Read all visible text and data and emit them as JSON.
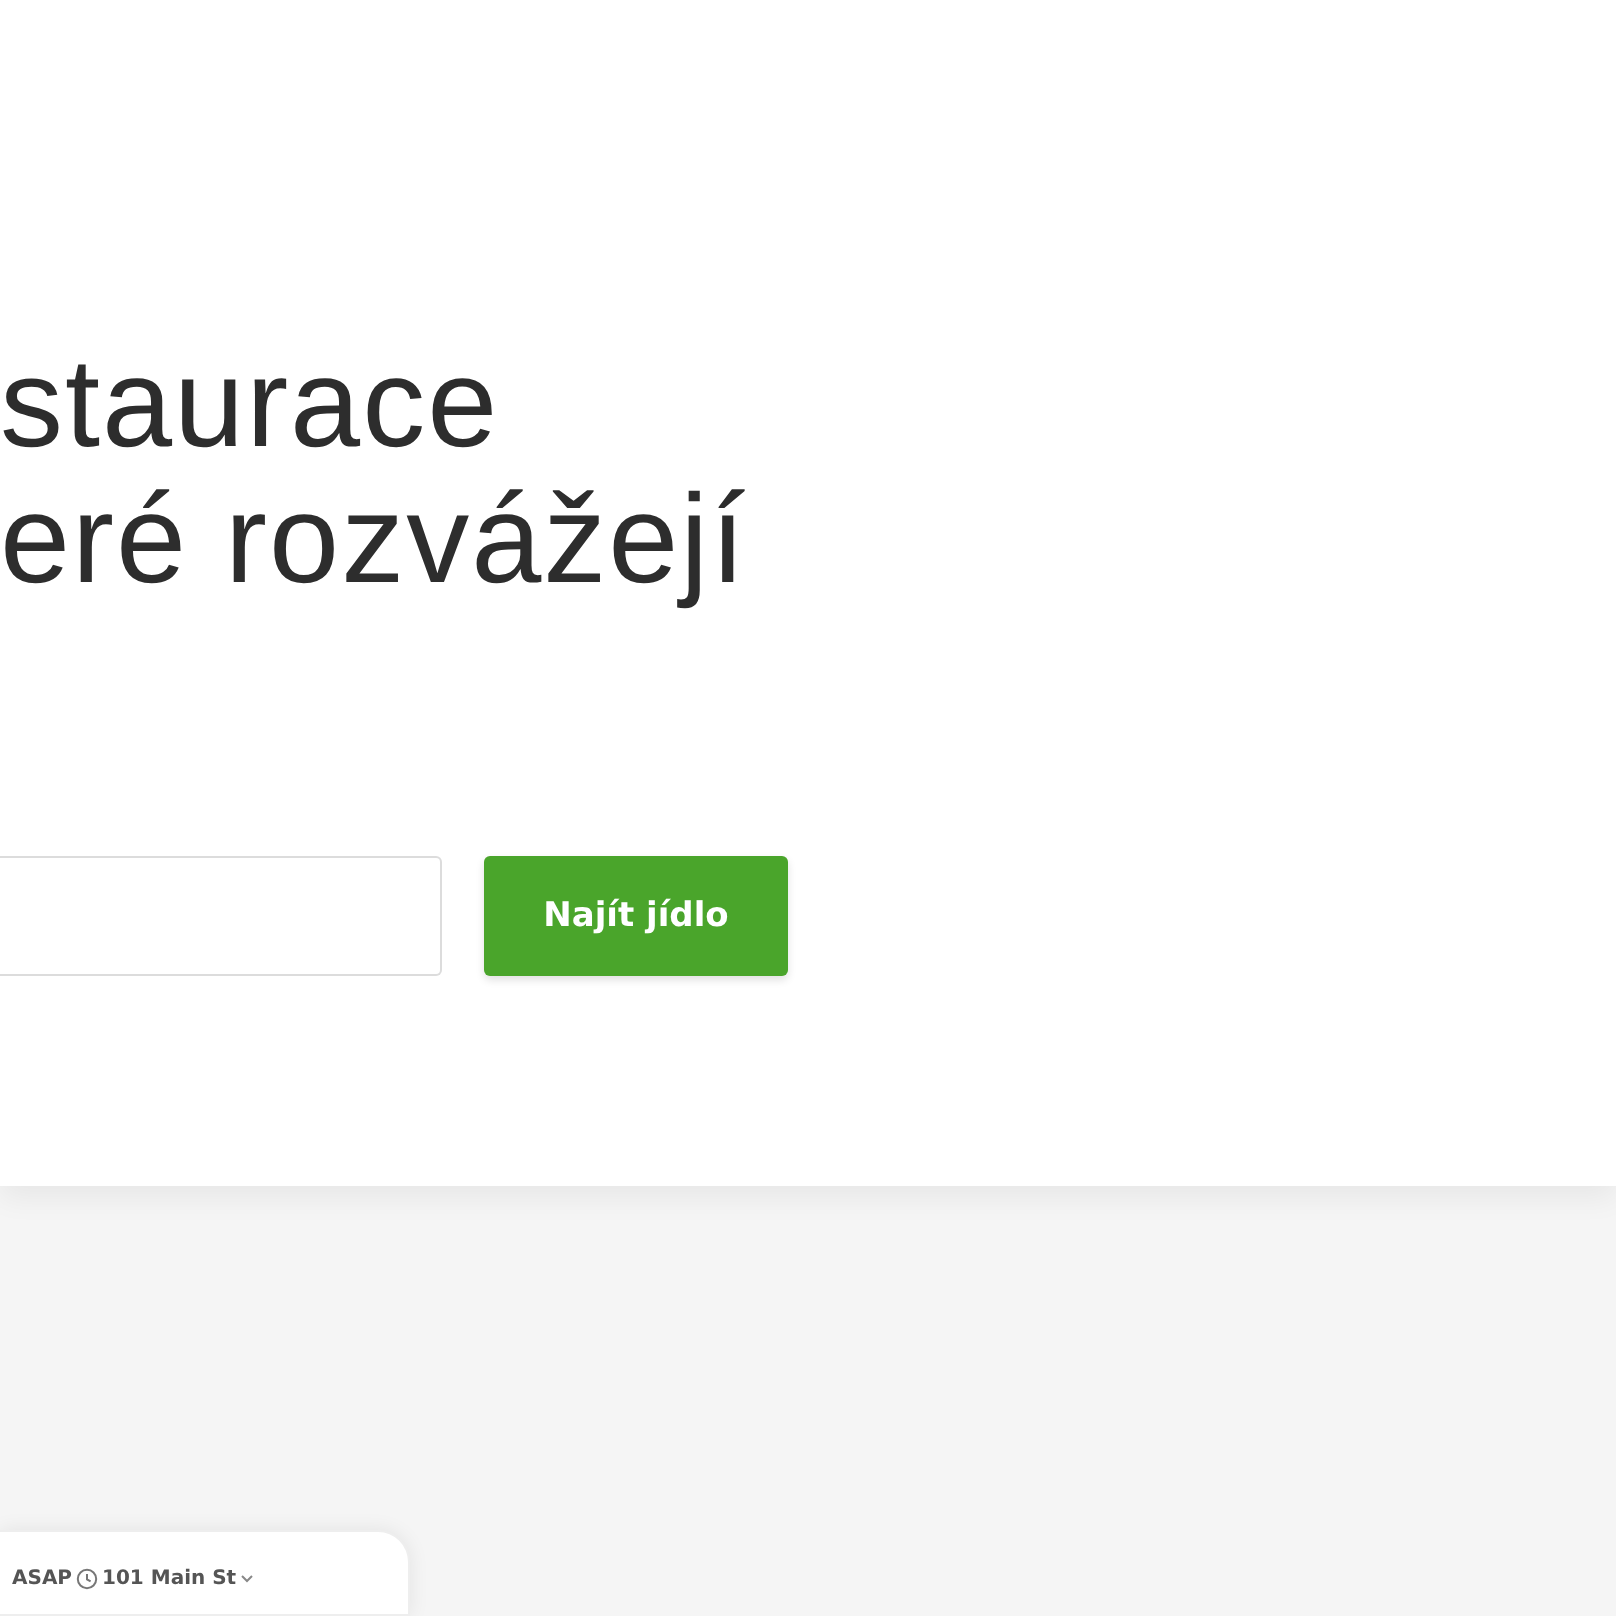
{
  "hero": {
    "heading_lines": [
      "staurace",
      "eré rozvážejí"
    ],
    "search_button": "Najít jídlo"
  },
  "phone_preview": {
    "time": "ASAP",
    "address": "101 Main St"
  }
}
